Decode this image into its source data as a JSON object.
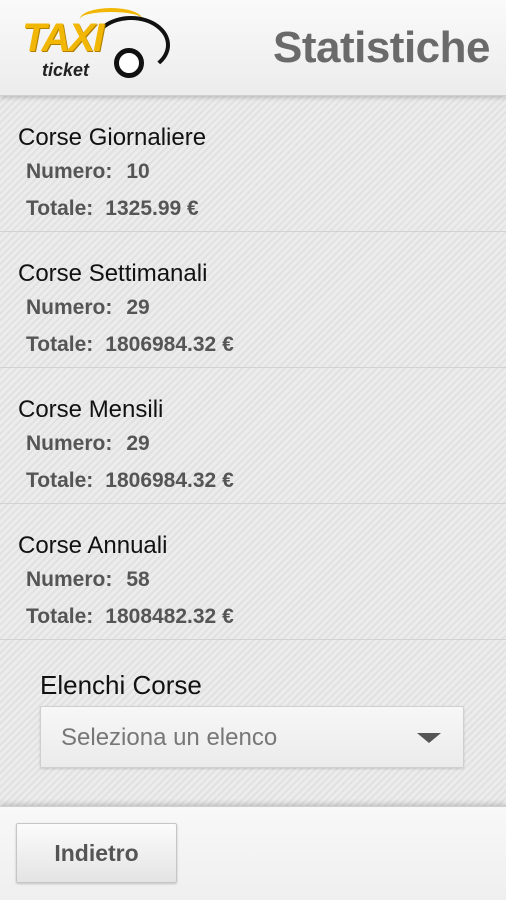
{
  "header": {
    "logo_main": "TAXI",
    "logo_sub": "ticket",
    "title": "Statistiche"
  },
  "stats": [
    {
      "title": "Corse Giornaliere",
      "numero_label": "Numero:",
      "numero": "10",
      "totale_label": "Totale:",
      "totale": "1325.99 €"
    },
    {
      "title": "Corse Settimanali",
      "numero_label": "Numero:",
      "numero": "29",
      "totale_label": "Totale:",
      "totale": "1806984.32 €"
    },
    {
      "title": "Corse Mensili",
      "numero_label": "Numero:",
      "numero": "29",
      "totale_label": "Totale:",
      "totale": "1806984.32 €"
    },
    {
      "title": "Corse Annuali",
      "numero_label": "Numero:",
      "numero": "58",
      "totale_label": "Totale:",
      "totale": "1808482.32 €"
    }
  ],
  "lists": {
    "title": "Elenchi Corse",
    "select_value": "Seleziona un elenco"
  },
  "footer": {
    "back_label": "Indietro"
  },
  "colors": {
    "logo_yellow": "#f2b705",
    "title_gray": "#6a6a6a"
  }
}
